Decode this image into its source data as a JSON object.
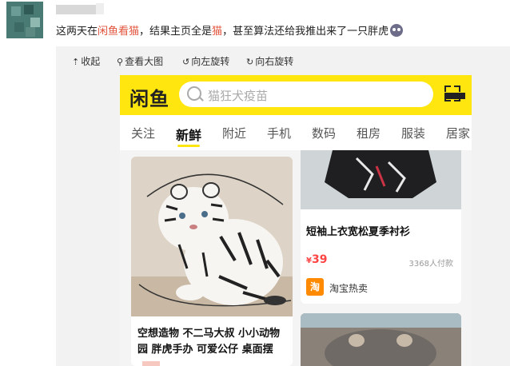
{
  "post": {
    "text_before": "这两天在",
    "keyword1": "闲鱼看猫",
    "text_middle": "，结果主页全是",
    "keyword2": "猫",
    "text_after": "，甚至算法还给我推出来了一只胖虎"
  },
  "toolbar": {
    "collapse": "收起",
    "view_large": "查看大图",
    "rotate_left": "向左旋转",
    "rotate_right": "向右旋转"
  },
  "app": {
    "logo": "闲鱼",
    "search_placeholder": "猫狂犬疫苗",
    "tabs": [
      "关注",
      "新鲜",
      "附近",
      "手机",
      "数码",
      "租房",
      "服装",
      "居家"
    ],
    "active_tab": "新鲜"
  },
  "feed": {
    "left_card": {
      "description": "空想造物 不二马大叔 小小动物园 胖虎手办 可爱公仔 桌面摆"
    },
    "right_card": {
      "title": "短袖上衣宽松夏季衬衫",
      "price_symbol": "¥",
      "price": "39",
      "buyers": "3368人付款",
      "shop_badge": "淘",
      "shop_name": "淘宝热卖"
    }
  },
  "colors": {
    "brand_yellow": "#ffe60f",
    "keyword_red": "#e2543c",
    "price_red": "#ff4444"
  }
}
